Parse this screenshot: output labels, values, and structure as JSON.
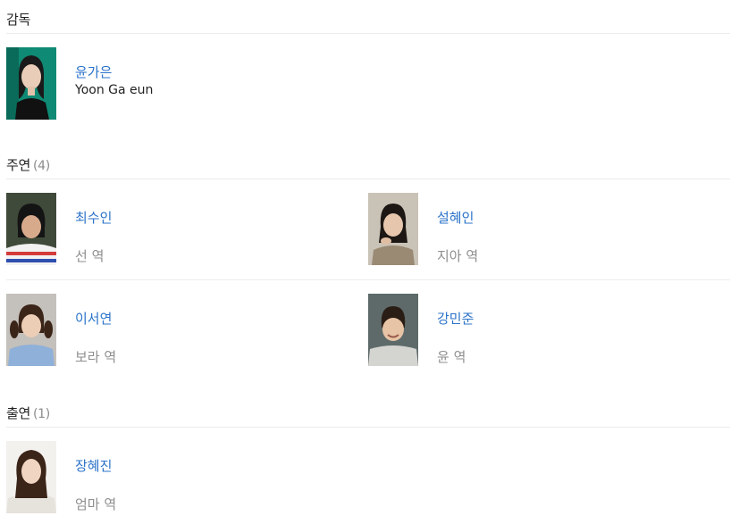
{
  "director_section": {
    "title": "감독",
    "people": [
      {
        "name": "윤가은",
        "name_en": "Yoon Ga eun"
      }
    ]
  },
  "lead_section": {
    "title": "주연",
    "count": "(4)",
    "people": [
      {
        "name": "최수인",
        "role": "선 역"
      },
      {
        "name": "설혜인",
        "role": "지아 역"
      },
      {
        "name": "이서연",
        "role": "보라 역"
      },
      {
        "name": "강민준",
        "role": "윤 역"
      }
    ]
  },
  "support_section": {
    "title": "출연",
    "count": "(1)",
    "people": [
      {
        "name": "장혜진",
        "role": "엄마 역"
      }
    ]
  },
  "colors": {
    "link": "#2b73c9",
    "role_text": "#8e8e8e",
    "divider": "#ececec"
  }
}
